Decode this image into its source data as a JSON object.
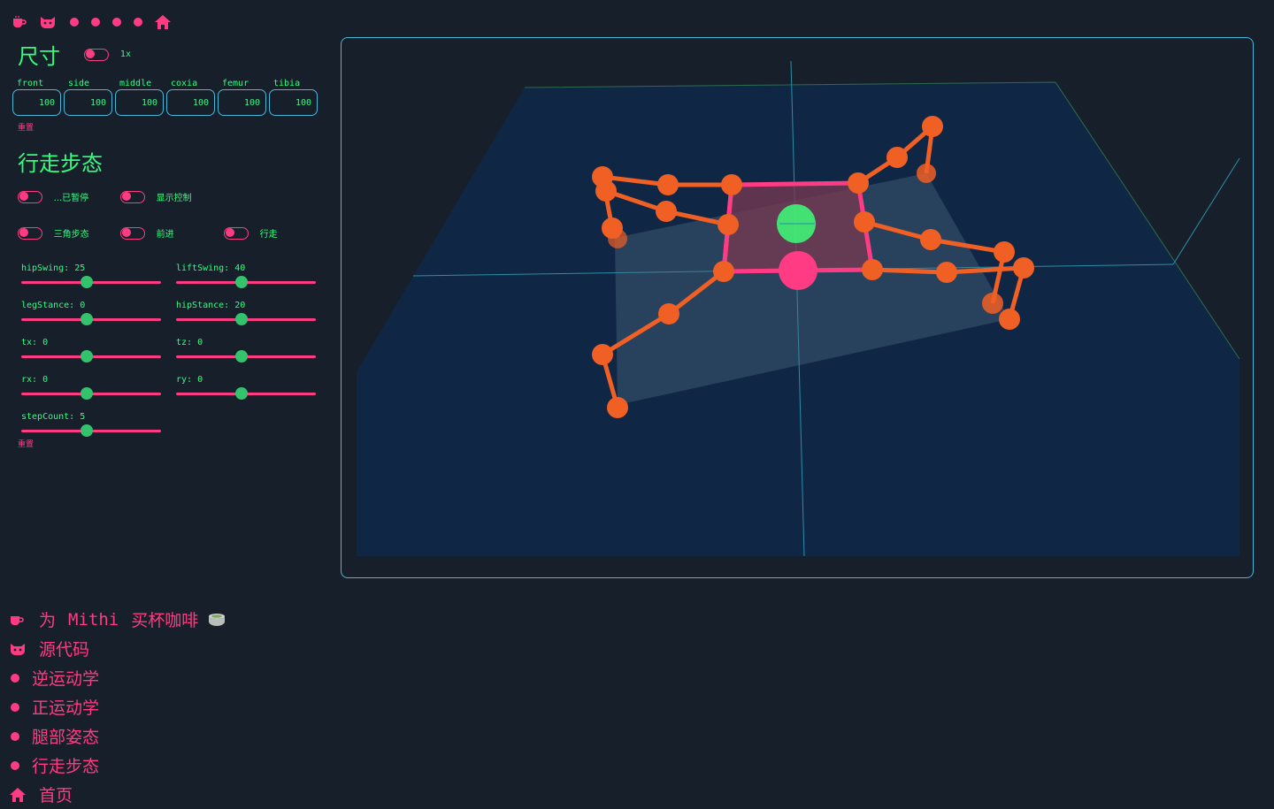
{
  "colors": {
    "accent": "#ff3c83",
    "text": "#32ff7e",
    "border": "#4ab7d8",
    "background": "#17202a",
    "leg": "#f05f24"
  },
  "topnav": {
    "icons": [
      "coffee-icon",
      "github-icon",
      "dot-icon",
      "dot-icon",
      "dot-icon",
      "dot-icon",
      "home-icon"
    ]
  },
  "dimensions": {
    "title": "尺寸",
    "scale_label": "1x",
    "fields": [
      {
        "label": "front",
        "value": "100"
      },
      {
        "label": "side",
        "value": "100"
      },
      {
        "label": "middle",
        "value": "100"
      },
      {
        "label": "coxia",
        "value": "100"
      },
      {
        "label": "femur",
        "value": "100"
      },
      {
        "label": "tibia",
        "value": "100"
      }
    ],
    "reset": "重置"
  },
  "gait": {
    "title": "行走步态",
    "toggles": [
      {
        "label": "...已暂停"
      },
      {
        "label": "显示控制"
      },
      {
        "label": ""
      },
      {
        "label": "三角步态"
      },
      {
        "label": "前进"
      },
      {
        "label": "行走"
      }
    ],
    "sliders": [
      {
        "label": "hipSwing: 25",
        "fraction": 0.47
      },
      {
        "label": "liftSwing: 40",
        "fraction": 0.47
      },
      {
        "label": "legStance: 0",
        "fraction": 0.47
      },
      {
        "label": "hipStance: 20",
        "fraction": 0.47
      },
      {
        "label": "tx: 0",
        "fraction": 0.47
      },
      {
        "label": "tz: 0",
        "fraction": 0.47
      },
      {
        "label": "rx: 0",
        "fraction": 0.47
      },
      {
        "label": "ry: 0",
        "fraction": 0.47
      },
      {
        "label": "stepCount: 5",
        "fraction": 0.47
      }
    ],
    "reset": "重置"
  },
  "bottom_links": [
    {
      "icon": "coffee-icon",
      "label_prefix": "为",
      "label_name": "Mithi",
      "label_suffix": "买杯咖啡",
      "trail_icon": "tea-icon"
    },
    {
      "icon": "github-icon",
      "label": "源代码"
    },
    {
      "icon": "dot-icon",
      "label": "逆运动学"
    },
    {
      "icon": "dot-icon",
      "label": "正运动学"
    },
    {
      "icon": "dot-icon",
      "label": "腿部姿态"
    },
    {
      "icon": "dot-icon",
      "label": "行走步态"
    },
    {
      "icon": "home-icon",
      "label": "首页"
    }
  ]
}
